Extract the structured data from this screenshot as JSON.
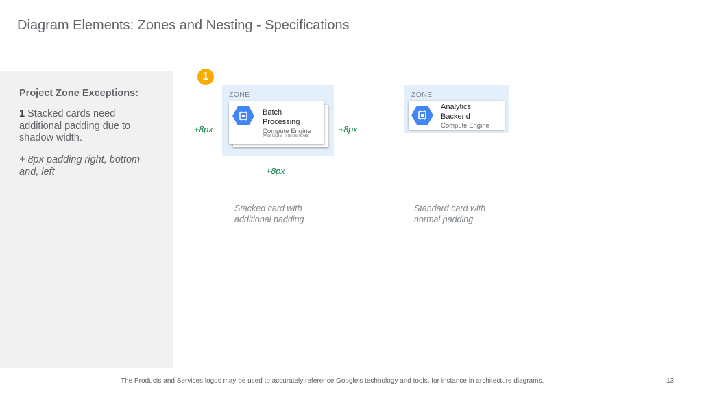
{
  "title": "Diagram Elements: Zones and Nesting - Specifications",
  "side": {
    "heading": "Project Zone Exceptions:",
    "note_number": "1",
    "note_text": " Stacked cards need additional padding due to shadow width.",
    "padding_note": "+ 8px padding right, bottom and, left"
  },
  "badge": "1",
  "stacked_example": {
    "zone_label": "ZONE",
    "card_name": "Batch Processing",
    "card_sub": "Compute Engine",
    "card_sub2": "Multiple Instances",
    "icon": "compute-engine-icon",
    "pad_left": "+8px",
    "pad_right": "+8px",
    "pad_bottom": "+8px",
    "caption": "Stacked card with additional padding"
  },
  "standard_example": {
    "zone_label": "ZONE",
    "card_name": "Analytics Backend",
    "card_sub": "Compute Engine",
    "icon": "compute-engine-icon",
    "caption": "Standard card with normal padding"
  },
  "footer": "The Products and Services logos may be used to accurately reference Google's technology and tools, for instance in architecture diagrams.",
  "page_number": "13",
  "colors": {
    "zone_fill": "#e3f0fb",
    "icon_blue": "#4285f4",
    "badge": "#f9ab00",
    "padding_text": "#0b8043",
    "side_panel": "#f1f1f1"
  }
}
